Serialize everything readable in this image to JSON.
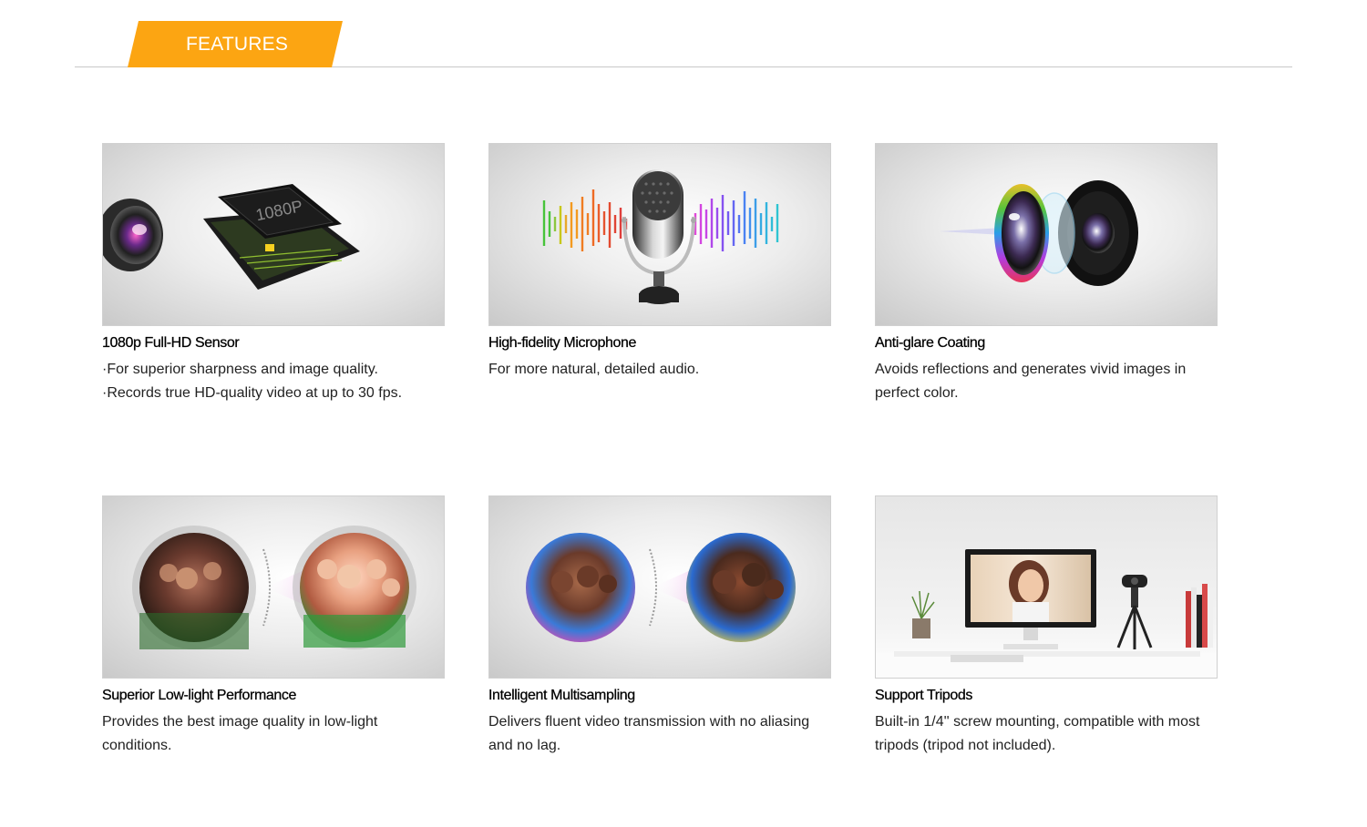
{
  "header": {
    "tab_label": "FEATURES"
  },
  "features": [
    {
      "title": "1080p Full-HD Sensor",
      "lines": [
        "·For superior sharpness and image quality.",
        "·Records true HD-quality video at up to 30 fps."
      ],
      "chip_text": "1080P"
    },
    {
      "title": "High-fidelity Microphone",
      "lines": [
        "For more natural, detailed audio."
      ]
    },
    {
      "title": "Anti-glare Coating",
      "lines": [
        "Avoids reflections and generates vivid images in",
        "perfect color."
      ]
    },
    {
      "title": "Superior Low-light Performance",
      "lines": [
        "Provides the best image quality in low-light",
        "conditions."
      ]
    },
    {
      "title": "Intelligent Multisampling",
      "lines": [
        "Delivers fluent video transmission with no aliasing",
        "and no lag."
      ]
    },
    {
      "title": "Support Tripods",
      "lines": [
        "Built-in 1/4'' screw mounting, compatible with most",
        "tripods (tripod not included)."
      ]
    }
  ],
  "colors": {
    "accent": "#fca512",
    "rule": "#c8c8c8",
    "pink": "#e060d8"
  }
}
